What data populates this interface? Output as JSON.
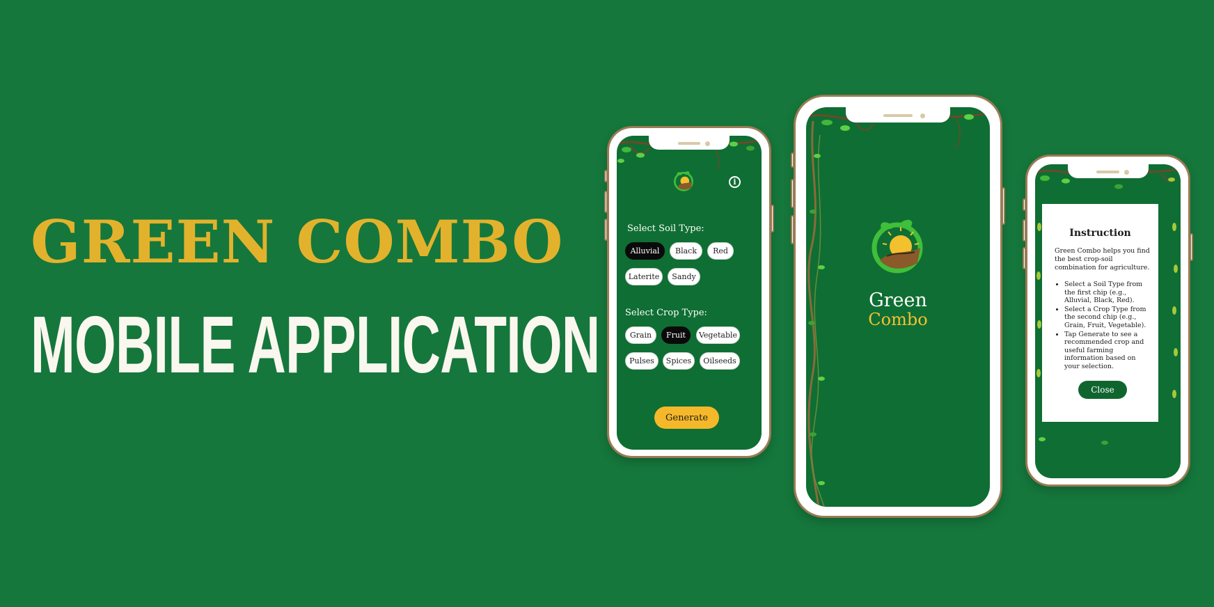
{
  "banner": {
    "title_line1": "GREEN COMBO",
    "title_line2": "MOBILE APPLICATION"
  },
  "colors": {
    "background": "#15773c",
    "title_gold": "#e3b22c",
    "title_white": "#faf7ee",
    "screen_green": "#0f6e33",
    "chip_selected": "#0a0a0a",
    "generate_yellow": "#f5b82a",
    "close_green": "#10652f"
  },
  "selection_screen": {
    "logo": "green-combo-logo",
    "info_icon": "info-icon",
    "soil_label": "Select Soil Type:",
    "soil_chips": [
      "Alluvial",
      "Black",
      "Red",
      "Laterite",
      "Sandy"
    ],
    "soil_selected": "Alluvial",
    "crop_label": "Select Crop Type:",
    "crop_chips": [
      "Grain",
      "Fruit",
      "Vegetable",
      "Pulses",
      "Spices",
      "Oilseeds"
    ],
    "crop_selected": "Fruit",
    "generate_label": "Generate"
  },
  "splash_screen": {
    "logo": "green-combo-logo",
    "name_line1": "Green",
    "name_line2": "Combo"
  },
  "instruction_dialog": {
    "title": "Instruction",
    "intro": "Green Combo helps you find the best crop-soil combination for agriculture.",
    "steps": [
      "Select a Soil Type from the first chip (e.g., Alluvial, Black, Red).",
      "Select a Crop Type from the second chip (e.g., Grain, Fruit, Vegetable).",
      "Tap Generate to see a recommended crop and useful farming information based on your selection."
    ],
    "close_label": "Close"
  }
}
